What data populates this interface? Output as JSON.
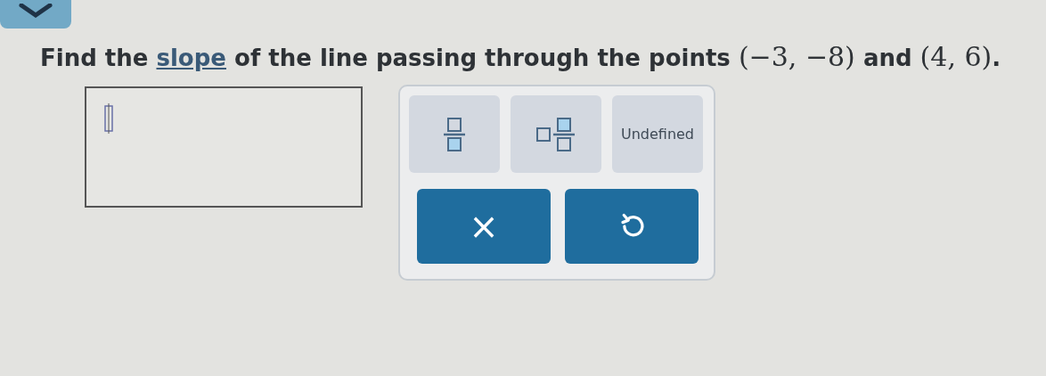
{
  "question": {
    "parts": [
      {
        "kind": "text",
        "text": "Find the "
      },
      {
        "kind": "link",
        "text": "slope"
      },
      {
        "kind": "text",
        "text": " of the line passing through the points "
      },
      {
        "kind": "math",
        "text": "(−3, −8)"
      },
      {
        "kind": "text",
        "text": " and "
      },
      {
        "kind": "math",
        "text": "(4, 6)"
      },
      {
        "kind": "text",
        "text": "."
      }
    ]
  },
  "keypad": {
    "keys": [
      {
        "kind": "fraction"
      },
      {
        "kind": "mixed"
      },
      {
        "kind": "text",
        "label": "Undefined"
      }
    ],
    "actions": [
      {
        "kind": "clear",
        "label": "×"
      },
      {
        "kind": "undo"
      }
    ]
  }
}
